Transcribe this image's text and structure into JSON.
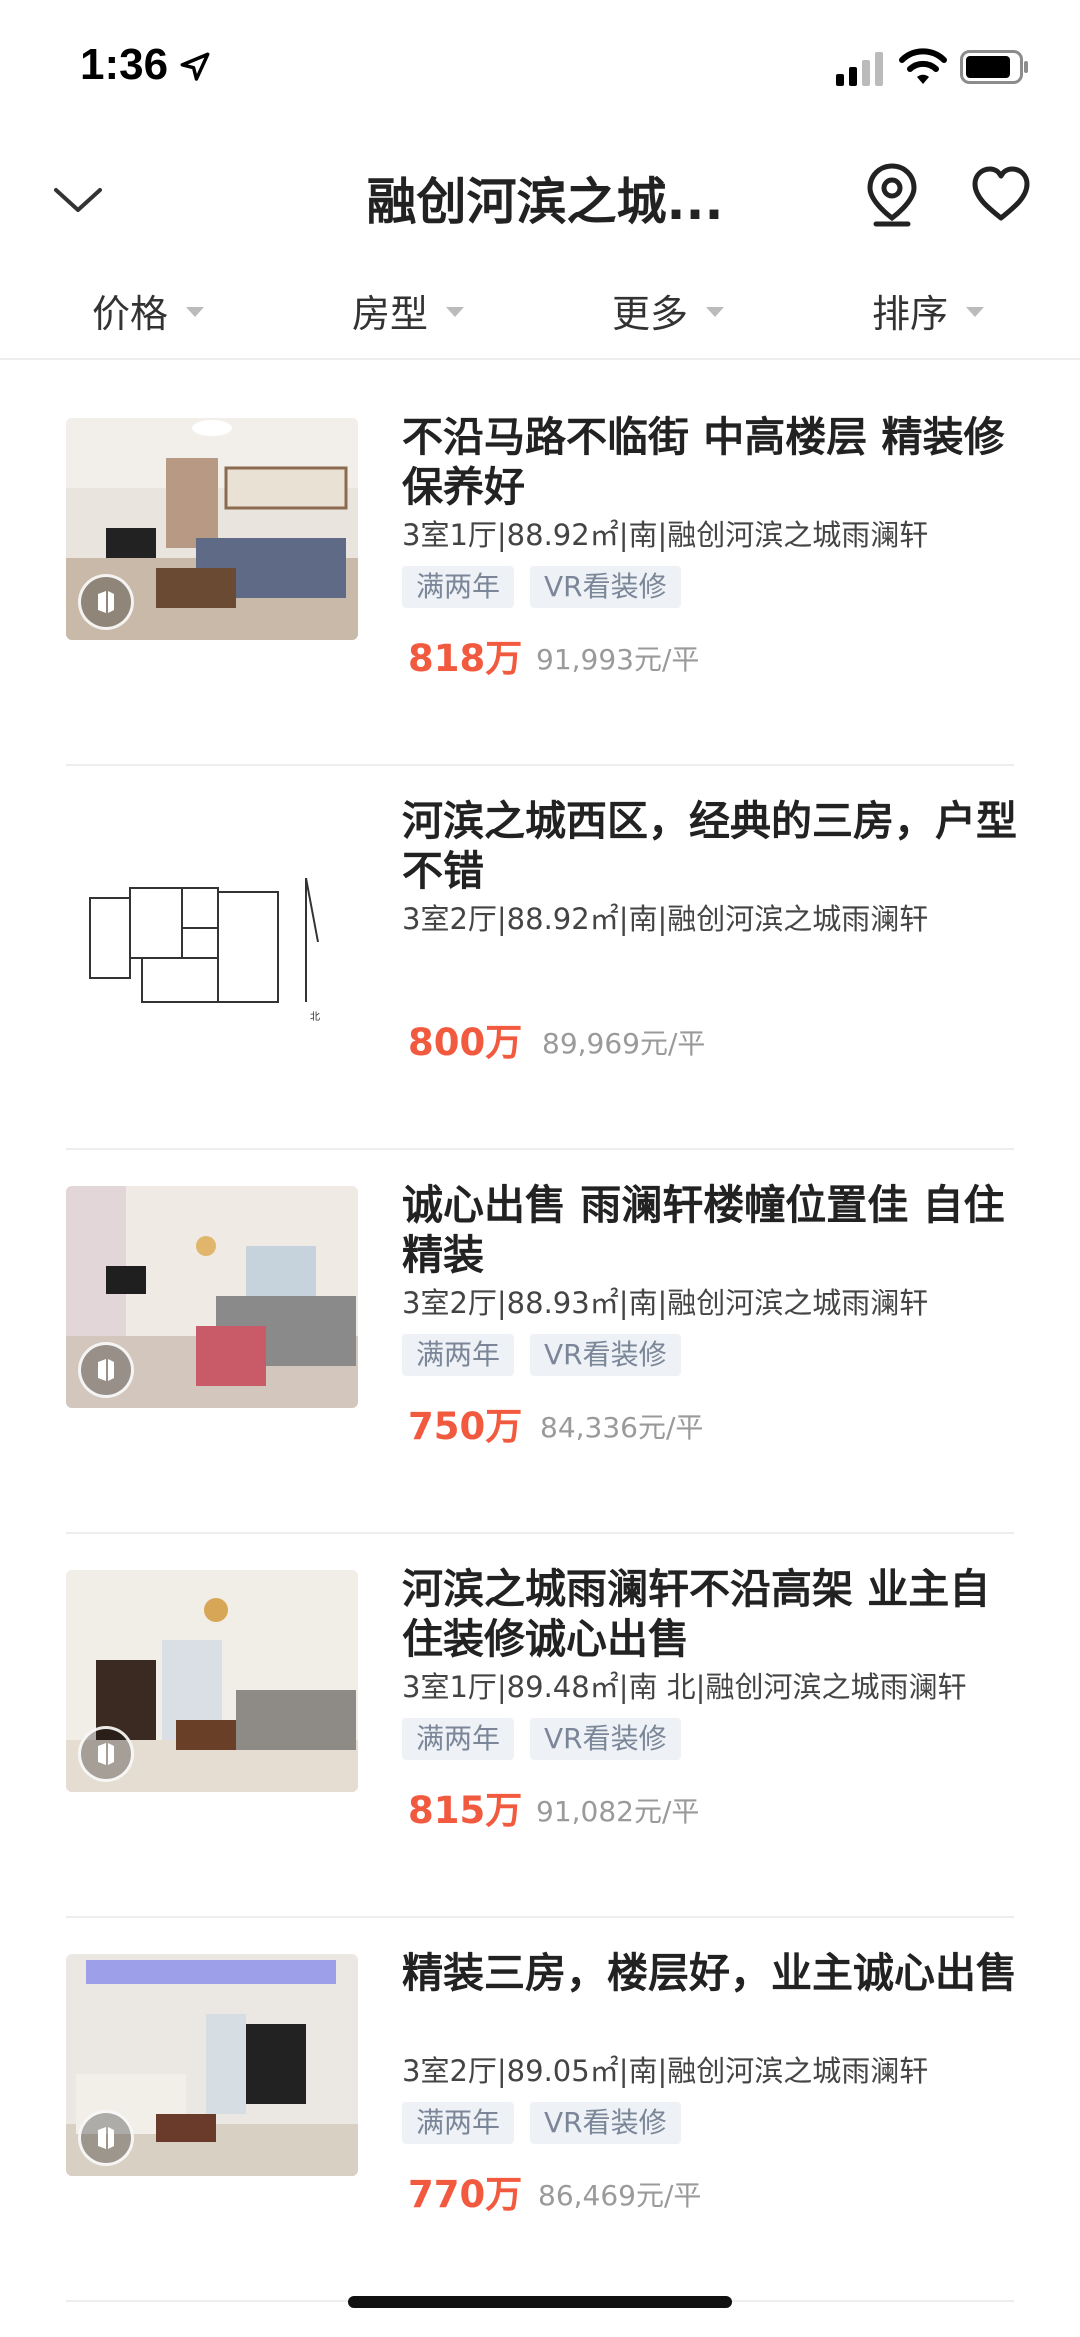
{
  "status_bar": {
    "time": "1:36"
  },
  "header": {
    "title": "融创河滨之城..."
  },
  "filters": [
    {
      "label": "价格"
    },
    {
      "label": "房型"
    },
    {
      "label": "更多"
    },
    {
      "label": "排序"
    }
  ],
  "listings": [
    {
      "title": "不沿马路不临街 中高楼层 精装修保养好",
      "meta": "3室1厅|88.92㎡|南|融创河滨之城雨澜轩",
      "tags": [
        "满两年",
        "VR看装修"
      ],
      "price": "818万",
      "unit_price": "91,993元/平",
      "image": "living-room-photo"
    },
    {
      "title": "河滨之城西区，经典的三房，户型不错",
      "meta": "3室2厅|88.92㎡|南|融创河滨之城雨澜轩",
      "tags": [],
      "price": "800万",
      "unit_price": "89,969元/平",
      "image": "floor-plan"
    },
    {
      "title": "诚心出售 雨澜轩楼幢位置佳 自住精装",
      "meta": "3室2厅|88.93㎡|南|融创河滨之城雨澜轩",
      "tags": [
        "满两年",
        "VR看装修"
      ],
      "price": "750万",
      "unit_price": "84,336元/平",
      "image": "living-room-photo"
    },
    {
      "title": "河滨之城雨澜轩不沿高架 业主自住装修诚心出售",
      "meta": "3室1厅|89.48㎡|南 北|融创河滨之城雨澜轩",
      "tags": [
        "满两年",
        "VR看装修"
      ],
      "price": "815万",
      "unit_price": "91,082元/平",
      "image": "living-room-photo"
    },
    {
      "title": "精装三房，楼层好，业主诚心出售",
      "meta": "3室2厅|89.05㎡|南|融创河滨之城雨澜轩",
      "tags": [
        "满两年",
        "VR看装修"
      ],
      "price": "770万",
      "unit_price": "86,469元/平",
      "image": "living-room-photo"
    }
  ],
  "colors": {
    "price": "#f25a3f",
    "tag_bg": "#eef1f5",
    "tag_text": "#7b8799"
  }
}
